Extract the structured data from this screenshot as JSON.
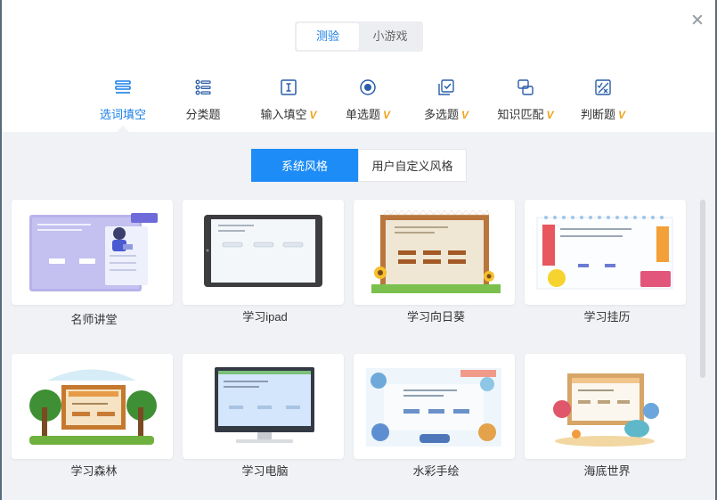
{
  "mode_tabs": [
    {
      "label": "测验",
      "active": true
    },
    {
      "label": "小游戏",
      "active": false
    }
  ],
  "types": [
    {
      "label": "选词填空",
      "icon": "fill-blank-icon",
      "vip": false,
      "active": true
    },
    {
      "label": "分类题",
      "icon": "category-icon",
      "vip": false,
      "active": false
    },
    {
      "label": "输入填空",
      "icon": "text-input-icon",
      "vip": true,
      "active": false
    },
    {
      "label": "单选题",
      "icon": "radio-icon",
      "vip": true,
      "active": false
    },
    {
      "label": "多选题",
      "icon": "checkbox-icon",
      "vip": true,
      "active": false
    },
    {
      "label": "知识匹配",
      "icon": "match-icon",
      "vip": true,
      "active": false
    },
    {
      "label": "判断题",
      "icon": "true-false-icon",
      "vip": true,
      "active": false
    }
  ],
  "vip_badge": "V",
  "style_tabs": {
    "system": "系统风格",
    "custom": "用户自定义风格"
  },
  "templates": [
    {
      "name": "名师讲堂"
    },
    {
      "name": "学习ipad"
    },
    {
      "name": "学习向日葵"
    },
    {
      "name": "学习挂历"
    },
    {
      "name": "学习森林"
    },
    {
      "name": "学习电脑"
    },
    {
      "name": "水彩手绘"
    },
    {
      "name": "海底世界"
    }
  ],
  "colors": {
    "accent": "#1e8cf7",
    "active_text": "#1a7fe5",
    "vip": "#f0a31b"
  }
}
